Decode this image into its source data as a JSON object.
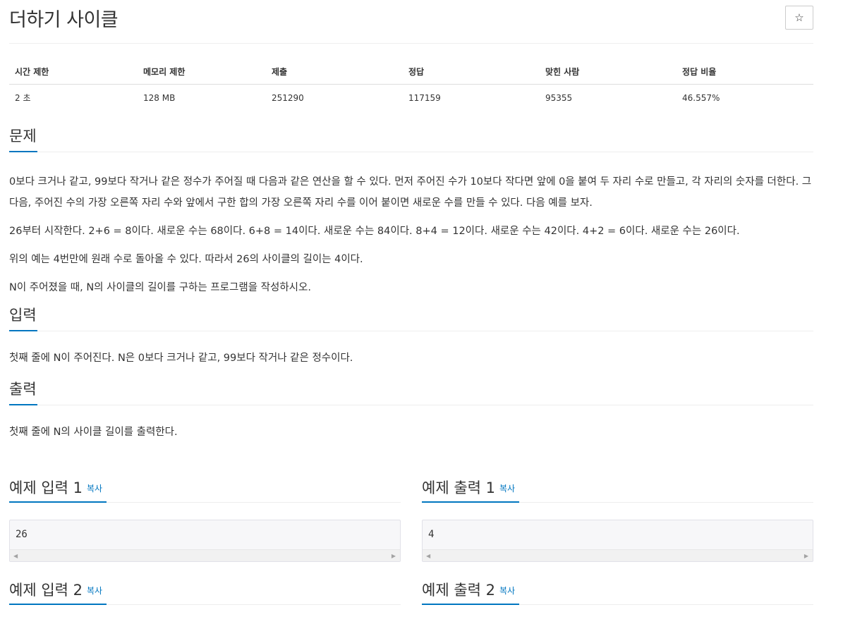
{
  "problem": {
    "title": "더하기 사이클",
    "star_label": "☆"
  },
  "info_table": {
    "headers": [
      "시간 제한",
      "메모리 제한",
      "제출",
      "정답",
      "맞힌 사람",
      "정답 비율"
    ],
    "values": [
      "2 초",
      "128 MB",
      "251290",
      "117159",
      "95355",
      "46.557%"
    ]
  },
  "sections": {
    "description": {
      "heading": "문제",
      "paragraphs": [
        "0보다 크거나 같고, 99보다 작거나 같은 정수가 주어질 때 다음과 같은 연산을 할 수 있다. 먼저 주어진 수가 10보다 작다면 앞에 0을 붙여 두 자리 수로 만들고, 각 자리의 숫자를 더한다. 그 다음, 주어진 수의 가장 오른쪽 자리 수와 앞에서 구한 합의 가장 오른쪽 자리 수를 이어 붙이면 새로운 수를 만들 수 있다. 다음 예를 보자.",
        "26부터 시작한다. 2+6 = 8이다. 새로운 수는 68이다. 6+8 = 14이다. 새로운 수는 84이다. 8+4 = 12이다. 새로운 수는 42이다. 4+2 = 6이다. 새로운 수는 26이다.",
        "위의 예는 4번만에 원래 수로 돌아올 수 있다. 따라서 26의 사이클의 길이는 4이다.",
        "N이 주어졌을 때, N의 사이클의 길이를 구하는 프로그램을 작성하시오."
      ]
    },
    "input": {
      "heading": "입력",
      "text": "첫째 줄에 N이 주어진다. N은 0보다 크거나 같고, 99보다 작거나 같은 정수이다."
    },
    "output": {
      "heading": "출력",
      "text": "첫째 줄에 N의 사이클 길이를 출력한다."
    }
  },
  "samples": {
    "copy_label": "복사",
    "input_1": {
      "heading": "예제 입력 1",
      "value": "26"
    },
    "output_1": {
      "heading": "예제 출력 1",
      "value": "4"
    },
    "input_2": {
      "heading": "예제 입력 2"
    },
    "output_2": {
      "heading": "예제 출력 2"
    }
  },
  "colors": {
    "accent": "#0076c0",
    "text": "#333333",
    "sample_bg": "#f7f7f9"
  }
}
